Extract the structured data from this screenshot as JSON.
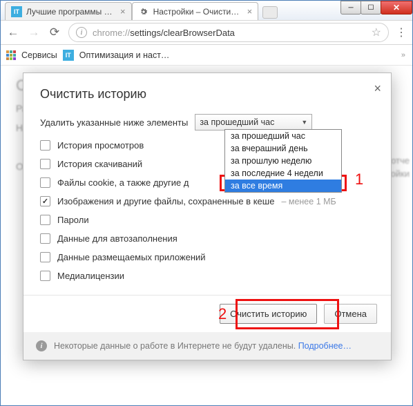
{
  "window": {
    "tabs": [
      {
        "title": "Лучшие программы дл…",
        "favicon": "IT"
      },
      {
        "title": "Настройки – Очистить и…",
        "favicon": "gear"
      }
    ],
    "url_prefix": "chrome://",
    "url_path": "settings/clearBrowserData"
  },
  "bookmarks": {
    "apps_label": "Сервисы",
    "item1_label": "Оптимизация и наст…"
  },
  "page_bg": {
    "h1": "Ch",
    "r1": "Ра",
    "r2": "На",
    "r3": "О",
    "right1": "и отче",
    "right2": "тройки"
  },
  "modal": {
    "title": "Очистить историю",
    "prompt": "Удалить указанные ниже элементы",
    "select_value": "за прошедший час",
    "options": [
      "за прошедший час",
      "за вчерашний день",
      "за прошлую неделю",
      "за последние 4 недели",
      "за все время"
    ],
    "selected_index": 4,
    "checks": [
      {
        "label": "История просмотров",
        "checked": false
      },
      {
        "label": "История скачиваний",
        "checked": false
      },
      {
        "label": "Файлы cookie, а также другие д",
        "checked": false
      },
      {
        "label": "Изображения и другие файлы, сохраненные в кеше",
        "checked": true,
        "hint": "–  менее 1 МБ"
      },
      {
        "label": "Пароли",
        "checked": false
      },
      {
        "label": "Данные для автозаполнения",
        "checked": false
      },
      {
        "label": "Данные размещаемых приложений",
        "checked": false
      },
      {
        "label": "Медиалицензии",
        "checked": false
      }
    ],
    "primary_btn": "Очистить историю",
    "cancel_btn": "Отмена",
    "note_text": "Некоторые данные о работе в Интернете не будут удалены. ",
    "note_link": "Подробнее…"
  },
  "callouts": {
    "one": "1",
    "two": "2"
  }
}
